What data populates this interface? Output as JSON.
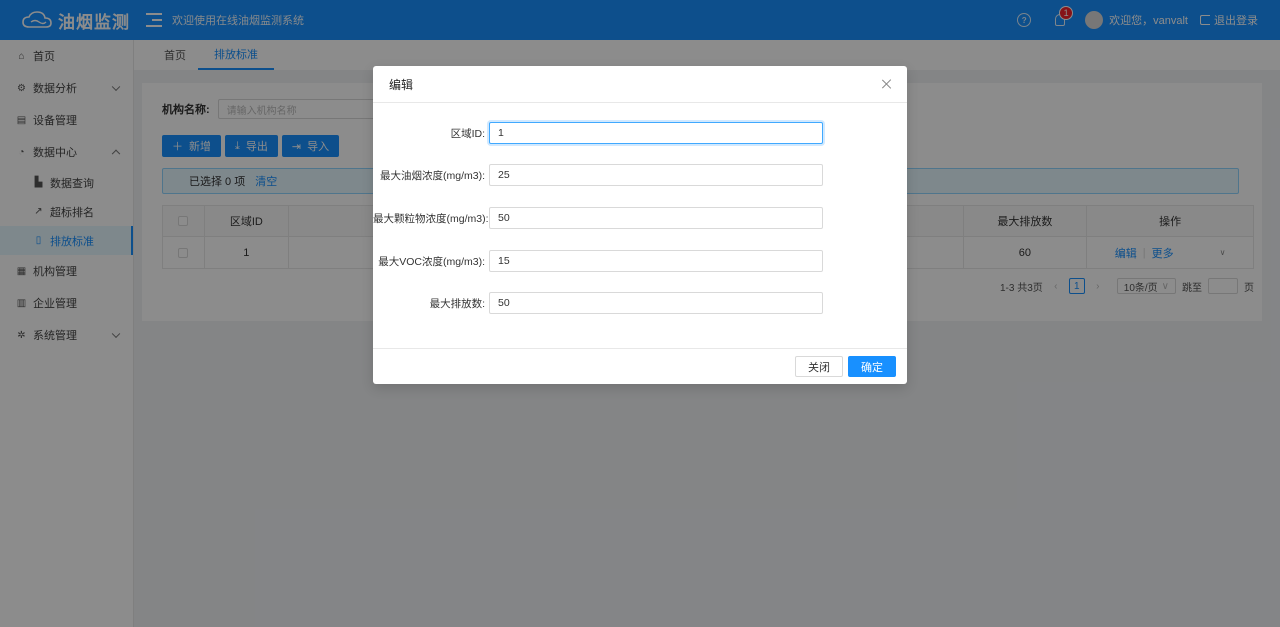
{
  "header": {
    "app_name": "油烟监测",
    "welcome": "欢迎使用在线油烟监测系统",
    "notification_count": "1",
    "user_greeting": "欢迎您，vanvalt",
    "logout_label": "退出登录",
    "help_glyph": "?"
  },
  "sidebar": {
    "items": [
      {
        "label": "首页",
        "icon": "home-icon"
      },
      {
        "label": "数据分析",
        "icon": "analysis-icon"
      },
      {
        "label": "设备管理",
        "icon": "device-icon"
      },
      {
        "label": "数据中心",
        "icon": "data-center-icon"
      },
      {
        "label": "数据查询",
        "icon": "chart-icon"
      },
      {
        "label": "超标排名",
        "icon": "trend-icon"
      },
      {
        "label": "排放标准",
        "icon": "document-icon"
      },
      {
        "label": "机构管理",
        "icon": "org-icon"
      },
      {
        "label": "企业管理",
        "icon": "enterprise-icon"
      },
      {
        "label": "系统管理",
        "icon": "settings-icon"
      }
    ]
  },
  "tabs": [
    {
      "label": "首页"
    },
    {
      "label": "排放标准"
    }
  ],
  "filter": {
    "label": "机构名称:",
    "placeholder": "请输入机构名称"
  },
  "toolbar": {
    "add_label": "新增",
    "export_label": "导出",
    "import_label": "导入"
  },
  "selection": {
    "text": "已选择 0 项",
    "clear_label": "清空"
  },
  "table": {
    "columns": [
      "区域ID",
      "最大排放数",
      "操作"
    ],
    "rows": [
      {
        "region_id": "1",
        "max_emission": "60",
        "edit": "编辑",
        "more": "更多"
      }
    ]
  },
  "pagination": {
    "summary": "1-3 共3页",
    "current_page": "1",
    "page_size": "10条/页",
    "jump_label": "跳至",
    "page_suffix": "页"
  },
  "modal": {
    "title": "编辑",
    "fields": [
      {
        "label": "区域ID:",
        "value": "1"
      },
      {
        "label": "最大油烟浓度(mg/m3):",
        "value": "25"
      },
      {
        "label": "最大颗粒物浓度(mg/m3):",
        "value": "50"
      },
      {
        "label": "最大VOC浓度(mg/m3):",
        "value": "15"
      },
      {
        "label": "最大排放数:",
        "value": "50"
      }
    ],
    "cancel_label": "关闭",
    "ok_label": "确定"
  },
  "colors": {
    "primary": "#1890ff",
    "badge": "#f5222d"
  }
}
